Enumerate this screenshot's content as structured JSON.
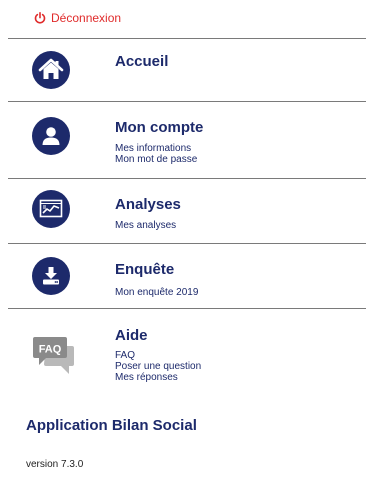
{
  "logout": {
    "label": "Déconnexion",
    "color": "#e02b2b"
  },
  "menu": [
    {
      "title": "Accueil",
      "subs": []
    },
    {
      "title": "Mon compte",
      "subs": [
        "Mes informations",
        "Mon mot de passe"
      ]
    },
    {
      "title": "Analyses",
      "subs": [
        "Mes analyses"
      ]
    },
    {
      "title": "Enquête",
      "subs": [
        "Mon enquête 2019"
      ]
    },
    {
      "title": "Aide",
      "subs": [
        "FAQ",
        "Poser une question",
        "Mes réponses"
      ],
      "icon_text": "FAQ"
    }
  ],
  "app_title": "Application Bilan Social",
  "version": "version 7.3.0",
  "colors": {
    "primary": "#1d2a6b",
    "divider": "#7a7a7a",
    "faq_icon": "#8a8a8a"
  }
}
